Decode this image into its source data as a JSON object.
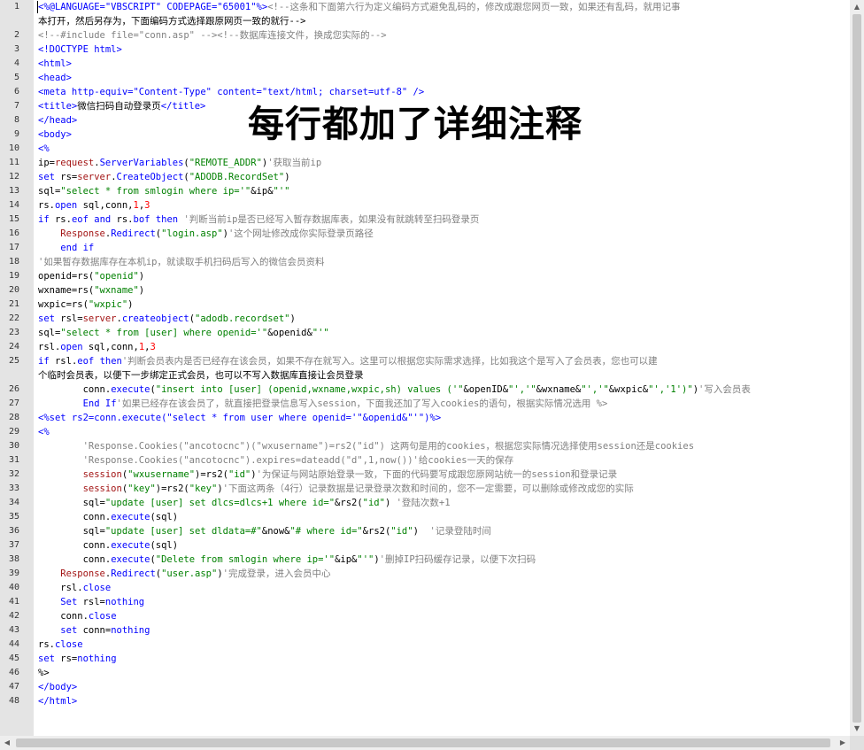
{
  "overlay_caption": "每行都加了详细注释",
  "lines": [
    {
      "n": "1",
      "text": "<%@LANGUAGE=\"VBSCRIPT\" CODEPAGE=\"65001\"%><!--这条和下面第六行为定义编码方式避免乱码的，修改成跟您网页一致，如果还有乱码，就用记事"
    },
    {
      "n": "",
      "text": "本打开，然后另存为，下面编码方式选择跟原网页一致的就行-->"
    },
    {
      "n": "2",
      "text": "<!--#include file=\"conn.asp\" --><!--数据库连接文件，换成您实际的-->"
    },
    {
      "n": "3",
      "text": "<!DOCTYPE html>"
    },
    {
      "n": "4",
      "text": "<html>"
    },
    {
      "n": "5",
      "text": "<head>"
    },
    {
      "n": "6",
      "text": "<meta http-equiv=\"Content-Type\" content=\"text/html; charset=utf-8\" />"
    },
    {
      "n": "7",
      "text": "<title>微信扫码自动登录页</title>"
    },
    {
      "n": "8",
      "text": "</head>"
    },
    {
      "n": "9",
      "text": "<body>"
    },
    {
      "n": "10",
      "text": "<%"
    },
    {
      "n": "11",
      "text": "ip=request.ServerVariables(\"REMOTE_ADDR\")'获取当前ip"
    },
    {
      "n": "12",
      "text": "set rs=server.CreateObject(\"ADODB.RecordSet\")"
    },
    {
      "n": "13",
      "text": "sql=\"select * from smlogin where ip='\"&ip&\"'\""
    },
    {
      "n": "14",
      "text": "rs.open sql,conn,1,3"
    },
    {
      "n": "15",
      "text": "if rs.eof and rs.bof then '判断当前ip是否已经写入暂存数据库表，如果没有就跳转至扫码登录页"
    },
    {
      "n": "16",
      "text": "    Response.Redirect(\"login.asp\")'这个网址修改成你实际登录页路径"
    },
    {
      "n": "17",
      "text": "    end if"
    },
    {
      "n": "18",
      "text": "'如果暂存数据库存在本机ip，就读取手机扫码后写入的微信会员资料"
    },
    {
      "n": "19",
      "text": "openid=rs(\"openid\")"
    },
    {
      "n": "20",
      "text": "wxname=rs(\"wxname\")"
    },
    {
      "n": "21",
      "text": "wxpic=rs(\"wxpic\")"
    },
    {
      "n": "22",
      "text": "set rsl=server.createobject(\"adodb.recordset\")"
    },
    {
      "n": "23",
      "text": "sql=\"select * from [user] where openid='\"&openid&\"'\""
    },
    {
      "n": "24",
      "text": "rsl.open sql,conn,1,3"
    },
    {
      "n": "25",
      "text": "if rsl.eof then'判断会员表内是否已经存在该会员，如果不存在就写入。这里可以根据您实际需求选择，比如我这个是写入了会员表，您也可以建"
    },
    {
      "n": "",
      "text": "个临时会员表，以便下一步绑定正式会员，也可以不写入数据库直接让会员登录"
    },
    {
      "n": "26",
      "text": "        conn.execute(\"insert into [user] (openid,wxname,wxpic,sh) values ('\"&openID&\"','\"&wxname&\"','\"&wxpic&\"','1')\")'写入会员表"
    },
    {
      "n": "27",
      "text": "        End If'如果已经存在该会员了，就直接把登录信息写入session，下面我还加了写入cookies的语句，根据实际情况选用 %>"
    },
    {
      "n": "28",
      "text": "<%set rs2=conn.execute(\"select * from user where openid='\"&openid&\"'\")%>"
    },
    {
      "n": "29",
      "text": "<%"
    },
    {
      "n": "30",
      "text": "        'Response.Cookies(\"ancotocnc\")(\"wxusername\")=rs2(\"id\") 这两句是用的cookies，根据您实际情况选择使用session还是cookies"
    },
    {
      "n": "31",
      "text": "        'Response.Cookies(\"ancotocnc\").expires=dateadd(\"d\",1,now())'给cookies一天的保存"
    },
    {
      "n": "32",
      "text": "        session(\"wxusername\")=rs2(\"id\")'为保证与网站原始登录一致，下面的代码要写成跟您原网站统一的session和登录记录"
    },
    {
      "n": "33",
      "text": "        session(\"key\")=rs2(\"key\")'下面这两条（4行）记录数据是记录登录次数和时间的，您不一定需要，可以删除或修改成您的实际"
    },
    {
      "n": "34",
      "text": "        sql=\"update [user] set dlcs=dlcs+1 where id=\"&rs2(\"id\") '登陆次数+1"
    },
    {
      "n": "35",
      "text": "        conn.execute(sql)"
    },
    {
      "n": "36",
      "text": "        sql=\"update [user] set dldata=#\"&now&\"# where id=\"&rs2(\"id\")  '记录登陆时间"
    },
    {
      "n": "37",
      "text": "        conn.execute(sql)"
    },
    {
      "n": "38",
      "text": "        conn.execute(\"Delete from smlogin where ip='\"&ip&\"'\")'删掉IP扫码缓存记录，以便下次扫码"
    },
    {
      "n": "39",
      "text": "    Response.Redirect(\"user.asp\")'完成登录，进入会员中心"
    },
    {
      "n": "40",
      "text": "    rsl.close"
    },
    {
      "n": "41",
      "text": "    Set rsl=nothing"
    },
    {
      "n": "42",
      "text": "    conn.close"
    },
    {
      "n": "43",
      "text": "    set conn=nothing"
    },
    {
      "n": "44",
      "text": "rs.close"
    },
    {
      "n": "45",
      "text": "set rs=nothing"
    },
    {
      "n": "46",
      "text": "%>"
    },
    {
      "n": "47",
      "text": "</body>"
    },
    {
      "n": "48",
      "text": "</html>"
    }
  ],
  "scrollbar": {
    "up": "▲",
    "down": "▼",
    "left": "◀",
    "right": "▶"
  }
}
